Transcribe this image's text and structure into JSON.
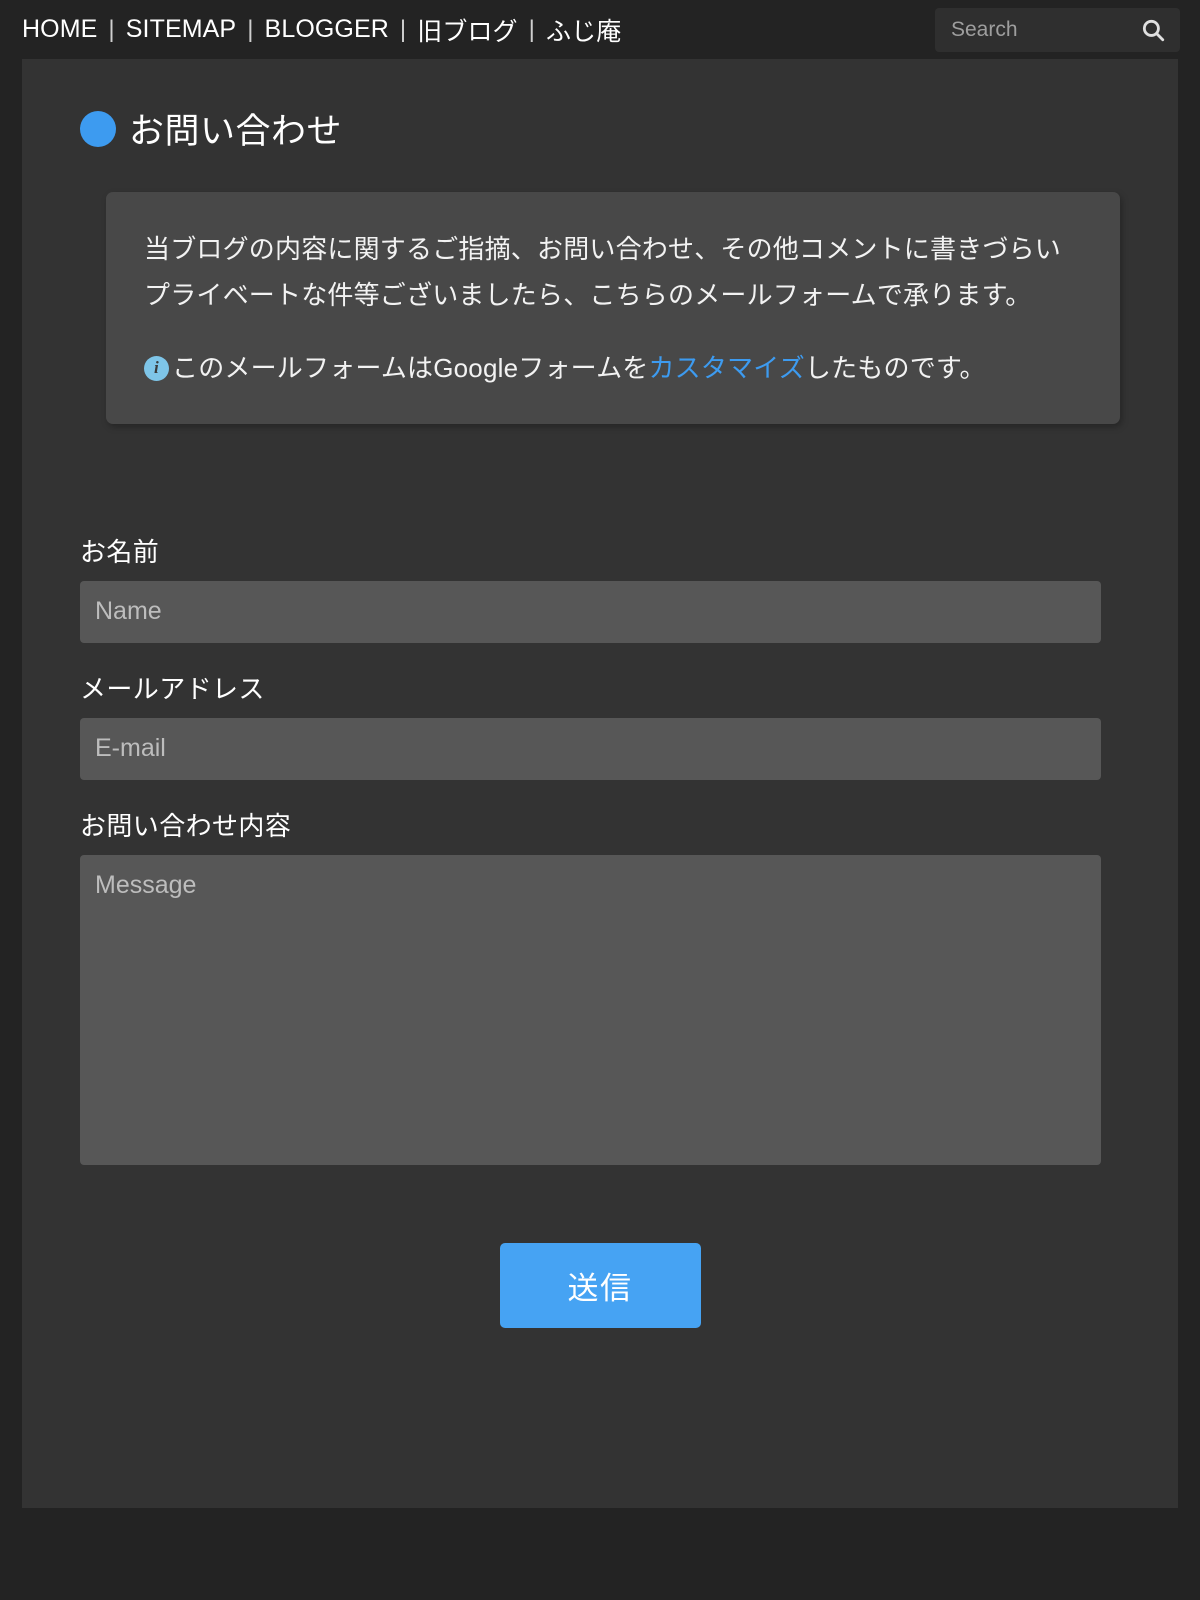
{
  "nav": {
    "separator": "|",
    "items": [
      {
        "label": "HOME"
      },
      {
        "label": "SITEMAP"
      },
      {
        "label": "BLOGGER"
      },
      {
        "label": "旧ブログ"
      },
      {
        "label": "ふじ庵"
      }
    ]
  },
  "search": {
    "placeholder": "Search",
    "value": "",
    "icon": "search-icon"
  },
  "page": {
    "title": "お問い合わせ",
    "bullet_color": "#3d9bf0"
  },
  "notice": {
    "paragraph": "当ブログの内容に関するご指摘、お問い合わせ、その他コメントに書きづらいプライベートな件等ございましたら、こちらのメールフォームで承ります。",
    "info_icon": "info-circle-icon",
    "info_prefix": "このメールフォームはGoogleフォームを",
    "info_link": "カスタマイズ",
    "info_suffix": "したものです。",
    "link_color": "#3d9bf0"
  },
  "form": {
    "fields": [
      {
        "label": "お名前",
        "placeholder": "Name",
        "value": "",
        "type": "text"
      },
      {
        "label": "メールアドレス",
        "placeholder": "E-mail",
        "value": "",
        "type": "email"
      },
      {
        "label": "お問い合わせ内容",
        "placeholder": "Message",
        "value": "",
        "type": "textarea"
      }
    ],
    "submit_label": "送信",
    "submit_color": "#46a3f3"
  }
}
